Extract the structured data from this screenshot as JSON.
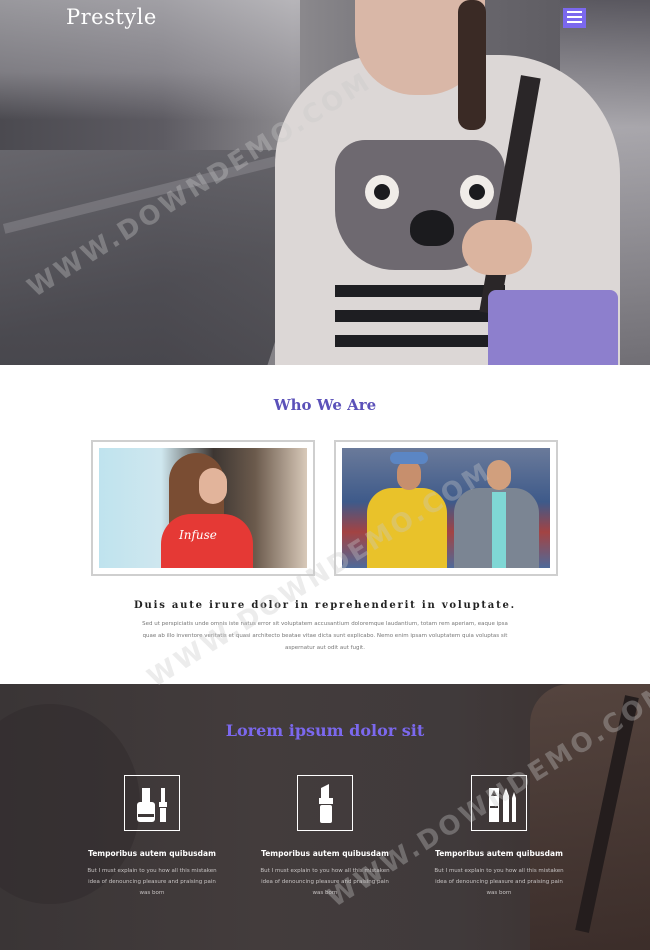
{
  "header": {
    "logo": "Prestyle",
    "menu_icon": "hamburger-icon"
  },
  "about": {
    "title": "Who We Are",
    "photo1_shirt_text": "Infuse",
    "headline": "Duis aute irure dolor in reprehenderit in voluptate.",
    "body": "Sed ut perspiciatis unde omnis iste natus error sit voluptatem accusantium doloremque laudantium, totam rem aperiam, eaque ipsa quae ab illo inventore veritatis et quasi architecto beatae vitae dicta sunt explicabo. Nemo enim ipsam voluptatem quia voluptas sit aspernatur aut odit aut fugit."
  },
  "features": {
    "title": "Lorem ipsum dolor sit",
    "items": [
      {
        "icon": "nail-polish-icon",
        "heading": "Temporibus autem quibusdam",
        "text": "But I must explain to you how all this mistaken idea of denouncing pleasure and praising pain was born"
      },
      {
        "icon": "lipstick-icon",
        "heading": "Temporibus autem quibusdam",
        "text": "But I must explain to you how all this mistaken idea of denouncing pleasure and praising pain was born"
      },
      {
        "icon": "makeup-pencils-icon",
        "heading": "Temporibus autem quibusdam",
        "text": "But I must explain to you how all this mistaken idea of denouncing pleasure and praising pain was born"
      }
    ]
  },
  "watermark": "WWW.DOWNDEMO.COM",
  "colors": {
    "accent": "#7b68ee",
    "title_purple": "#5b51b9",
    "dark_bg": "#3e3838"
  }
}
